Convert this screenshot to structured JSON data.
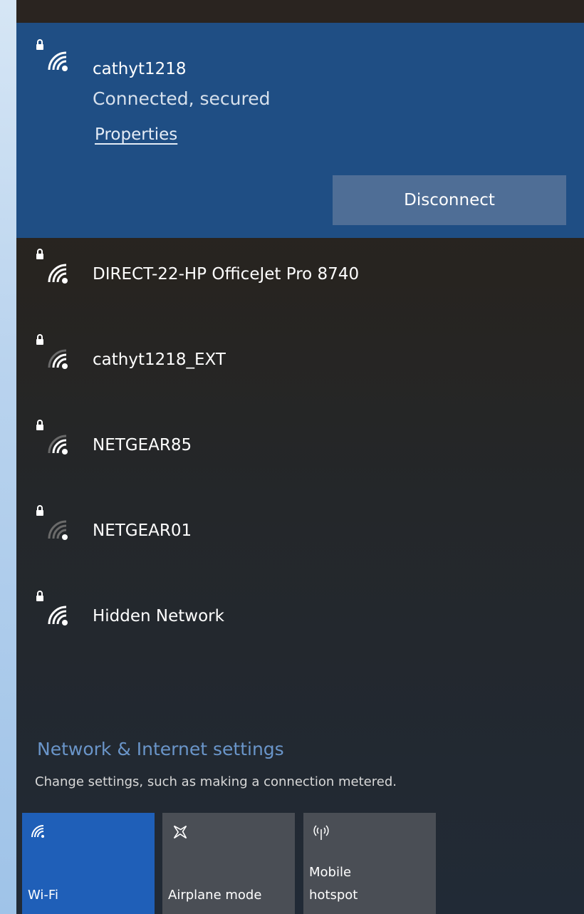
{
  "connected_network": {
    "name": "cathyt1218",
    "status": "Connected, secured",
    "properties_label": "Properties",
    "disconnect_label": "Disconnect"
  },
  "networks": [
    {
      "name": "DIRECT-22-HP OfficeJet Pro 8740",
      "signal_bars": 4,
      "secured": true
    },
    {
      "name": "cathyt1218_EXT",
      "signal_bars": 3,
      "secured": true
    },
    {
      "name": "NETGEAR85",
      "signal_bars": 3,
      "secured": true
    },
    {
      "name": "NETGEAR01",
      "signal_bars": 1,
      "secured": true
    },
    {
      "name": "Hidden Network",
      "signal_bars": 4,
      "secured": true
    }
  ],
  "settings": {
    "title": "Network & Internet settings",
    "subtitle": "Change settings, such as making a connection metered."
  },
  "quick_actions": {
    "wifi": {
      "label": "Wi-Fi",
      "active": true
    },
    "airplane": {
      "label": "Airplane mode",
      "active": false
    },
    "hotspot": {
      "label_line1": "Mobile",
      "label_line2": "hotspot",
      "active": false
    }
  },
  "colors": {
    "accent": "#1f4e84",
    "tile_active": "#1f5fb8",
    "tile_inactive": "#4a4e55",
    "link": "#6a95c9"
  }
}
